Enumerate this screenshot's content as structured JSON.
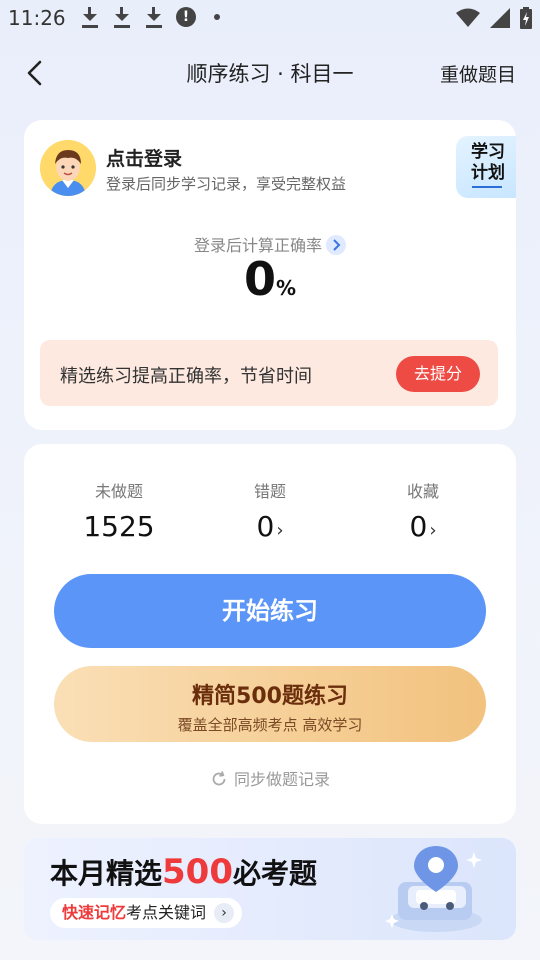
{
  "status_bar": {
    "time": "11:26",
    "left_icons": [
      "download-icon",
      "download-icon",
      "download-icon",
      "alert-icon",
      "dot-icon"
    ],
    "right_icons": [
      "wifi-icon",
      "signal-icon",
      "battery-charging-icon"
    ]
  },
  "nav": {
    "title": "顺序练习 · 科目一",
    "redo_label": "重做题目"
  },
  "login_card": {
    "title": "点击登录",
    "subtitle": "登录后同步学习记录，享受完整权益",
    "plan_badge": "学习计划",
    "accuracy_label": "登录后计算正确率",
    "accuracy_value": "0",
    "accuracy_unit": "%",
    "promo_text": "精选练习提高正确率，节省时间",
    "promo_button": "去提分"
  },
  "stats_card": {
    "stats": [
      {
        "label": "未做题",
        "value": "1525"
      },
      {
        "label": "错题",
        "value": "0"
      },
      {
        "label": "收藏",
        "value": "0"
      }
    ],
    "start_button": "开始练习",
    "simple_title": "精简500题练习",
    "simple_subtitle": "覆盖全部高频考点 高效学习",
    "sync_link": "同步做题记录"
  },
  "banner": {
    "title_prefix": "本月精选",
    "title_highlight": "500",
    "title_suffix": "必考题",
    "chip_highlight": "快速记忆",
    "chip_rest": "考点关键词"
  },
  "colors": {
    "primary_blue": "#5b95f7",
    "promo_red": "#ee4b45",
    "gold_start": "#fadfb6",
    "gold_end": "#f2c27e"
  }
}
